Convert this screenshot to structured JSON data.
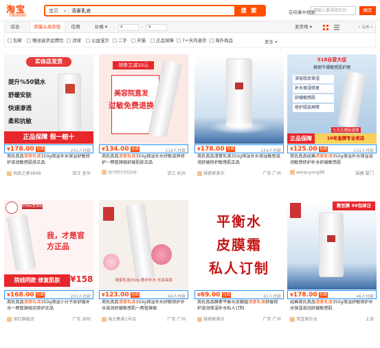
{
  "header": {
    "logo_cn": "淘宝",
    "logo_en": "Taobao",
    "search_category": "宝贝",
    "search_query": "清豪乳液",
    "search_button": "搜 索",
    "within_label": "在结果中搜索",
    "within_placeholder": "请输入要排除的词",
    "within_button": "确定"
  },
  "sortbar": {
    "items": [
      "综合",
      "销量从高到低",
      "信用",
      "价格"
    ],
    "price_min": "¥",
    "price_max": "¥",
    "ship_label": "发货地",
    "pager": "1/4"
  },
  "filters": [
    "包邮",
    "赠送退货运费险",
    "消保",
    "公益宝贝",
    "二手",
    "天猫",
    "正品保障",
    "7+天内退货",
    "海外商品"
  ],
  "filter_more": "更多",
  "products": [
    {
      "price": "178.00",
      "sales": "251人付款",
      "title_pre": "周氏真品",
      "title_hl": "清豪乳液",
      "title_post": "350g保湿补水保湿舒敏修护滋润敏感肌肤正品",
      "shop": "尚品之家9898",
      "loc": "浙江 金华",
      "img": {
        "lines": [
          "实体店发货",
          "提升%50锁水",
          "舒缓安肤",
          "快速渗透",
          "柔和抗敏",
          "正品保障 假一赔十"
        ]
      }
    },
    {
      "price": "134.00",
      "sales": "214人付款",
      "title_pre": "周氏真品",
      "title_hl": "清豪乳液",
      "title_post": "350g保湿补水好敏滋养修护一两管旗舰舒缓肌肤正品",
      "shop": "tb795530206",
      "loc": "浙江 杭州",
      "img": {
        "lines": [
          "领券立减10元",
          "美容院直发",
          "过敏免费退换"
        ]
      }
    },
    {
      "price": "178.00",
      "sales": "154人付款",
      "title_pre": "周氏真品清豪乳液350g保湿补水保湿敏感滋润舒缓修护敏感肌正品",
      "title_hl": "",
      "title_post": "",
      "shop": "慧丽家美乐",
      "loc": "广东 广州",
      "img": {
        "lines": []
      }
    },
    {
      "price": "125.00",
      "sales": "131人付款",
      "title_pre": "周氏真品经典",
      "title_hl": "清豪乳液",
      "title_post": "350g保湿补水保湿滋润敏感修护补水舒缓敏感肌",
      "shop": "weiquyong88",
      "loc": "福建 厦门",
      "img": {
        "lines": [
          "518自营大促",
          "推倒干燥敏感肌护理",
          "深层肌底保湿",
          "补水保湿修复",
          "舒缓敏感肌",
          "修护肌肤屏障",
          "七天无理由退换",
          "正品保障",
          "10年金牌专业老店"
        ]
      }
    },
    {
      "price": "168.00",
      "sales": "201人付款",
      "title_pre": "周氏真品",
      "title_hl": "清豪乳液",
      "title_post": "350g保湿小分子肤舒缓补水一两管旗舰店修护正品",
      "shop": "深红旗舰店",
      "loc": "广东 深圳",
      "img": {
        "lines": [
          "防伪码查真假",
          "我，才是官方正品",
          "院线同款 修复肌肤",
          "¥158"
        ]
      }
    },
    {
      "price": "123.00",
      "sales": "66人付款",
      "title_pre": "周氏真品",
      "title_hl": "清豪乳液",
      "title_post": "350g保湿补水好敏修护补水滋润舒缓敏感肌一两管旗舰",
      "shop": "瑞士集美1号店",
      "loc": "广东 广州",
      "img": {
        "lines": [
          "清豪乳液350g 精华补水 光泽亮丽"
        ]
      }
    },
    {
      "price": "69.00",
      "sales": "61人付款",
      "title_pre": "周氏真品酵素平衡水皮膜霜",
      "title_hl": "清豪乳液",
      "title_post": "舒缓修护滋润保湿补水私人订制",
      "shop": "慧丽家美乐",
      "loc": "广东 广州",
      "img": {
        "lines": [
          "平衡水",
          "皮膜霜",
          "私人订制"
        ]
      }
    },
    {
      "price": "178.00",
      "sales": "46人付款",
      "title_pre": "经典周氏真品",
      "title_hl": "清豪乳液",
      "title_post": "350g保湿好敏修护补水保湿滋润舒缓敏感肌",
      "shop": "淘宝美乐仓",
      "loc": "上海",
      "img": {
        "lines": [
          "聚划算 99包邮日"
        ]
      }
    }
  ],
  "colors": {
    "accent": "#ff4400",
    "highlight_border": "#1e90ff"
  }
}
